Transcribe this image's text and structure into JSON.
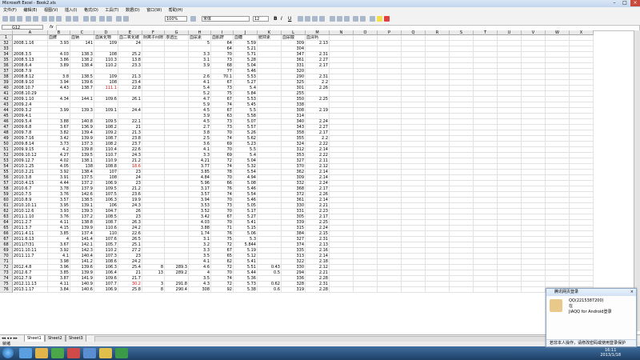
{
  "window": {
    "title": "Microsoft Excel - Book2.xls"
  },
  "menu": [
    "文件(F)",
    "编辑(E)",
    "视图(V)",
    "插入(I)",
    "格式(O)",
    "工具(T)",
    "数据(D)",
    "窗口(W)",
    "帮助(H)"
  ],
  "toolbar": {
    "zoom": "100%",
    "font": "宋体",
    "size": "12"
  },
  "formula": {
    "namebox": "G12",
    "fx": "fx",
    "value": ""
  },
  "columns": [
    "A",
    "B",
    "C",
    "D",
    "E",
    "F",
    "G",
    "H",
    "I",
    "J",
    "K",
    "L",
    "M",
    "N",
    "O",
    "P",
    "Q",
    "R",
    "S",
    "T",
    "U",
    "V",
    "W",
    "X"
  ],
  "header_row": {
    "num": "1",
    "B": "血脾",
    "C": "血钠",
    "D": "血氯化物",
    "E": "血二氧化碳",
    "F": "阴离子间隙",
    "G": "渗透压",
    "H": "血尿素",
    "I": "血肌酐",
    "J": "血糖",
    "K": "胱抑素",
    "L": "血尿酸",
    "M": "血清钙"
  },
  "rows": [
    {
      "num": "32",
      "A": "2008.1.16",
      "B": "3.93",
      "C": "141",
      "D": "109",
      "E": "24",
      "F": "",
      "G": "",
      "H": "5",
      "I": "64",
      "J": "5.59",
      "K": "",
      "L": "309",
      "M": "2.13"
    },
    {
      "num": "33",
      "A": "",
      "B": "",
      "C": "",
      "D": "",
      "E": "",
      "F": "",
      "G": "",
      "H": "",
      "I": "64",
      "J": "5.21",
      "K": "",
      "L": "304",
      "M": ""
    },
    {
      "num": "34",
      "A": "2008.3.5",
      "B": "4.03",
      "C": "138.3",
      "D": "108",
      "E": "25.2",
      "F": "",
      "G": "",
      "H": "3.3",
      "I": "70",
      "J": "5.71",
      "K": "",
      "L": "347",
      "M": "2.31"
    },
    {
      "num": "35",
      "A": "2008.5.13",
      "B": "3.86",
      "C": "138.2",
      "D": "110.3",
      "E": "13.8",
      "F": "",
      "G": "",
      "H": "3.1",
      "I": "73",
      "J": "5.28",
      "K": "",
      "L": "361",
      "M": "2.27"
    },
    {
      "num": "36",
      "A": "2008.6.4",
      "B": "3.89",
      "C": "138.4",
      "D": "110.2",
      "E": "23.3",
      "F": "",
      "G": "",
      "H": "3.9",
      "I": "68",
      "J": "5.04",
      "K": "",
      "L": "331",
      "M": "2.17"
    },
    {
      "num": "37",
      "A": "2008.7.9",
      "B": "",
      "C": "",
      "D": "",
      "E": "",
      "F": "",
      "G": "",
      "H": "",
      "I": "77",
      "J": "5.46",
      "K": "",
      "L": "320",
      "M": ""
    },
    {
      "num": "38",
      "A": "2008.8.12",
      "B": "3.8",
      "C": "138.5",
      "D": "109",
      "E": "21.3",
      "F": "",
      "G": "",
      "H": "2.6",
      "I": "70.1",
      "J": "5.53",
      "K": "",
      "L": "290",
      "M": "2.31"
    },
    {
      "num": "39",
      "A": "2008.9.10",
      "B": "3.94",
      "C": "139.6",
      "D": "108",
      "E": "23.4",
      "F": "",
      "G": "",
      "H": "4.1",
      "I": "67",
      "J": "5.27",
      "K": "",
      "L": "325",
      "M": "2.2"
    },
    {
      "num": "40",
      "A": "2008.10.7",
      "B": "4.43",
      "C": "138.7",
      "D": "111.1",
      "E": "22.8",
      "F": "",
      "G": "",
      "H": "5.4",
      "I": "73",
      "J": "5.4",
      "K": "",
      "L": "301",
      "M": "2.26"
    },
    {
      "num": "41",
      "A": "2008.10.29",
      "B": "",
      "C": "",
      "D": "",
      "E": "",
      "F": "",
      "G": "",
      "H": "5.2",
      "I": "75",
      "J": "5.84",
      "K": "",
      "L": "255",
      "M": ""
    },
    {
      "num": "42",
      "A": "2009.1.10",
      "B": "4.34",
      "C": "144.1",
      "D": "109.6",
      "E": "26.1",
      "F": "",
      "G": "",
      "H": "4.7",
      "I": "67",
      "J": "5.53",
      "K": "",
      "L": "350",
      "M": "2.25"
    },
    {
      "num": "43",
      "A": "2009.2.4",
      "B": "",
      "C": "",
      "D": "",
      "E": "",
      "F": "",
      "G": "",
      "H": "5.9",
      "I": "74",
      "J": "5.45",
      "K": "",
      "L": "338",
      "M": ""
    },
    {
      "num": "44",
      "A": "2009.3.2",
      "B": "3.99",
      "C": "139.3",
      "D": "109.1",
      "E": "24.4",
      "F": "",
      "G": "",
      "H": "4.5",
      "I": "67",
      "J": "5.5",
      "K": "",
      "L": "308",
      "M": "2.19"
    },
    {
      "num": "45",
      "A": "2009.4.1",
      "B": "",
      "C": "",
      "D": "",
      "E": "",
      "F": "",
      "G": "",
      "H": "3.9",
      "I": "63",
      "J": "5.58",
      "K": "",
      "L": "314",
      "M": ""
    },
    {
      "num": "46",
      "A": "2009.5.4",
      "B": "3.88",
      "C": "140.8",
      "D": "109.5",
      "E": "22.1",
      "F": "",
      "G": "",
      "H": "4.5",
      "I": "73",
      "J": "5.07",
      "K": "",
      "L": "340",
      "M": "2.24"
    },
    {
      "num": "47",
      "A": "2009.6.8",
      "B": "3.67",
      "C": "136.9",
      "D": "108.2",
      "E": "21",
      "F": "",
      "G": "",
      "H": "2.7",
      "I": "73",
      "J": "5.57",
      "K": "",
      "L": "343",
      "M": "2.27"
    },
    {
      "num": "48",
      "A": "2009.7.8",
      "B": "3.82",
      "C": "139.4",
      "D": "109.2",
      "E": "21.3",
      "F": "",
      "G": "",
      "H": "3.8",
      "I": "70",
      "J": "5.26",
      "K": "",
      "L": "358",
      "M": "2.17"
    },
    {
      "num": "49",
      "A": "2009.7.16",
      "B": "3.42",
      "C": "139.9",
      "D": "108.7",
      "E": "23.8",
      "F": "",
      "G": "",
      "H": "2.5",
      "I": "74",
      "J": "5.62",
      "K": "",
      "L": "355",
      "M": "2.2"
    },
    {
      "num": "50",
      "A": "2009.8.14",
      "B": "3.73",
      "C": "137.3",
      "D": "108.2",
      "E": "23.7",
      "F": "",
      "G": "",
      "H": "3.6",
      "I": "69",
      "J": "5.23",
      "K": "",
      "L": "324",
      "M": "2.22"
    },
    {
      "num": "51",
      "A": "2009.9.15",
      "B": "4.2",
      "C": "139.8",
      "D": "110.4",
      "E": "22.6",
      "F": "",
      "G": "",
      "H": "4.1",
      "I": "70",
      "J": "5.5",
      "K": "",
      "L": "312",
      "M": "2.14"
    },
    {
      "num": "52",
      "A": "2009.10.12",
      "B": "4.27",
      "C": "139.5",
      "D": "110.7",
      "E": "24.3",
      "F": "",
      "G": "",
      "H": "3.3",
      "I": "69",
      "J": "5.4",
      "K": "",
      "L": "353",
      "M": "2.22"
    },
    {
      "num": "53",
      "A": "2009.12.7",
      "B": "4.02",
      "C": "138.1",
      "D": "110.9",
      "E": "21.2",
      "F": "",
      "G": "",
      "H": "4.21",
      "I": "72",
      "J": "5.04",
      "K": "",
      "L": "327",
      "M": "2.11"
    },
    {
      "num": "54",
      "A": "2010.1.25",
      "B": "4.05",
      "C": "138",
      "D": "108.8",
      "E": "18.6",
      "F": "",
      "G": "",
      "H": "3.77",
      "I": "74",
      "J": "5.32",
      "K": "",
      "L": "370",
      "M": "2.12"
    },
    {
      "num": "55",
      "A": "2010.2.21",
      "B": "3.92",
      "C": "138.4",
      "D": "107",
      "E": "23",
      "F": "",
      "G": "",
      "H": "3.85",
      "I": "78",
      "J": "5.54",
      "K": "",
      "L": "362",
      "M": "2.14"
    },
    {
      "num": "56",
      "A": "2010.3.8",
      "B": "3.91",
      "C": "137.5",
      "D": "108",
      "E": "24",
      "F": "",
      "G": "",
      "H": "4.84",
      "I": "70",
      "J": "4.94",
      "K": "",
      "L": "309",
      "M": "2.14"
    },
    {
      "num": "57",
      "A": "2010.4.15",
      "B": "4.44",
      "C": "137.2",
      "D": "106.9",
      "E": "23",
      "F": "",
      "G": "",
      "H": "5.96",
      "I": "66",
      "J": "5.08",
      "K": "",
      "L": "332",
      "M": "2.24"
    },
    {
      "num": "58",
      "A": "2010.6.7",
      "B": "3.78",
      "C": "137.9",
      "D": "109.5",
      "E": "21.2",
      "F": "",
      "G": "",
      "H": "3.17",
      "I": "76",
      "J": "5.46",
      "K": "",
      "L": "368",
      "M": "2.17"
    },
    {
      "num": "59",
      "A": "2010.7.5",
      "B": "3.76",
      "C": "142.6",
      "D": "107.5",
      "E": "23.6",
      "F": "",
      "G": "",
      "H": "3.57",
      "I": "74",
      "J": "5.54",
      "K": "",
      "L": "372",
      "M": "2.26"
    },
    {
      "num": "60",
      "A": "2010.8.9",
      "B": "3.57",
      "C": "138.5",
      "D": "106.3",
      "E": "19.9",
      "F": "",
      "G": "",
      "H": "3.94",
      "I": "70",
      "J": "5.46",
      "K": "",
      "L": "361",
      "M": "2.14"
    },
    {
      "num": "61",
      "A": "2010.10.11",
      "B": "3.95",
      "C": "139.1",
      "D": "106",
      "E": "24.3",
      "F": "",
      "G": "",
      "H": "3.53",
      "I": "73",
      "J": "5.05",
      "K": "",
      "L": "330",
      "M": "2.21"
    },
    {
      "num": "62",
      "A": "2010.12.6",
      "B": "3.93",
      "C": "139.3",
      "D": "104.7",
      "E": "26",
      "F": "",
      "G": "",
      "H": "3.52",
      "I": "70",
      "J": "5.17",
      "K": "",
      "L": "331",
      "M": "2.23"
    },
    {
      "num": "63",
      "A": "2011.1.10",
      "B": "3.76",
      "C": "137.2",
      "D": "108.5",
      "E": "23",
      "F": "",
      "G": "",
      "H": "3.42",
      "I": "67",
      "J": "5.27",
      "K": "",
      "L": "305",
      "M": "2.17"
    },
    {
      "num": "64",
      "A": "2011.2.7",
      "B": "4.11",
      "C": "138.8",
      "D": "108.7",
      "E": "26.3",
      "F": "",
      "G": "",
      "H": "4.03",
      "I": "70",
      "J": "5.41",
      "K": "",
      "L": "339",
      "M": "2.25"
    },
    {
      "num": "65",
      "A": "2011.3.7",
      "B": "4.15",
      "C": "139.9",
      "D": "110.6",
      "E": "24.2",
      "F": "",
      "G": "",
      "H": "3.88",
      "I": "71",
      "J": "5.15",
      "K": "",
      "L": "315",
      "M": "2.24"
    },
    {
      "num": "66",
      "A": "2011.4.11",
      "B": "3.85",
      "C": "137.4",
      "D": "110",
      "E": "22.6",
      "F": "",
      "G": "",
      "H": "1.74",
      "I": "76",
      "J": "5.06",
      "K": "",
      "L": "384",
      "M": "2.15"
    },
    {
      "num": "67",
      "A": "2011.6.13",
      "B": "4",
      "C": "141.4",
      "D": "107.6",
      "E": "26.5",
      "F": "",
      "G": "",
      "H": "3.1",
      "I": "75",
      "J": "5.3",
      "K": "",
      "L": "327",
      "M": "2.31"
    },
    {
      "num": "68",
      "A": "2011/7/31",
      "B": "3.67",
      "C": "142.1",
      "D": "105.7",
      "E": "25.1",
      "F": "",
      "G": "",
      "H": "3.2",
      "I": "72",
      "J": "5.844",
      "K": "",
      "L": "374",
      "M": "2.13"
    },
    {
      "num": "69",
      "A": "2011.10.11",
      "B": "3.92",
      "C": "142.3",
      "D": "110.2",
      "E": "27.2",
      "F": "",
      "G": "",
      "H": "3.3",
      "I": "67",
      "J": "5.19",
      "K": "",
      "L": "335",
      "M": "2.16"
    },
    {
      "num": "70",
      "A": "2011.11.7",
      "B": "4.1",
      "C": "140.4",
      "D": "107.3",
      "E": "23",
      "F": "",
      "G": "",
      "H": "3.5",
      "I": "65",
      "J": "5.12",
      "K": "",
      "L": "313",
      "M": "2.14"
    },
    {
      "num": "71",
      "A": "",
      "B": "3.98",
      "C": "141.2",
      "D": "108.6",
      "E": "24.2",
      "F": "",
      "G": "",
      "H": "4.1",
      "I": "62",
      "J": "5.41",
      "K": "",
      "L": "322",
      "M": "2.18"
    },
    {
      "num": "72",
      "A": "2012.4.8",
      "B": "3.96",
      "C": "139.6",
      "D": "106.3",
      "E": "25.4",
      "F": "8",
      "G": "289.3",
      "H": "4.6",
      "I": "72",
      "J": "5.51",
      "K": "0.43",
      "L": "330",
      "M": "2.12"
    },
    {
      "num": "73",
      "A": "2012.6.7",
      "B": "3.85",
      "C": "139.9",
      "D": "106.4",
      "E": "21",
      "F": "13",
      "G": "289.2",
      "H": "4",
      "I": "70",
      "J": "5.44",
      "K": "0.5",
      "L": "294",
      "M": "2.21"
    },
    {
      "num": "74",
      "A": "2012.7.9",
      "B": "3.87",
      "C": "141.9",
      "D": "109.6",
      "E": "21.7",
      "F": "",
      "G": "",
      "H": "3.5",
      "I": "74",
      "J": "5.36",
      "K": "",
      "L": "336",
      "M": "2.28"
    },
    {
      "num": "75",
      "A": "2012.11.13",
      "B": "4.11",
      "C": "140.9",
      "D": "107.7",
      "E": "30.2",
      "F": "3",
      "G": "291.8",
      "H": "4.3",
      "I": "72",
      "J": "5.73",
      "K": "0.62",
      "L": "328",
      "M": "2.31"
    },
    {
      "num": "76",
      "A": "2013.1.17",
      "B": "3.84",
      "C": "140.6",
      "D": "106.9",
      "E": "25.8",
      "F": "8",
      "G": "290.4",
      "H": "308",
      "I": "92",
      "J": "5.38",
      "K": "0.6",
      "L": "319",
      "M": "2.28"
    }
  ],
  "red_cells": [
    "40.D",
    "54.E",
    "75.E"
  ],
  "sheet_tabs": [
    "Sheet1",
    "Sheet2",
    "Sheet3"
  ],
  "status": "就绪",
  "clock": {
    "time": "16:11",
    "date": "2013/1/18"
  },
  "notification": {
    "header": "腾讯网页登录",
    "line1": "QQ(2215387200)",
    "line2": "在",
    "line3": "JiAQQ for Android登录",
    "footer": "若非本人操作，请修改密码或使用登录保护"
  },
  "colors": {
    "red_text": "#d01010",
    "taskbar": "#1e3f66"
  }
}
